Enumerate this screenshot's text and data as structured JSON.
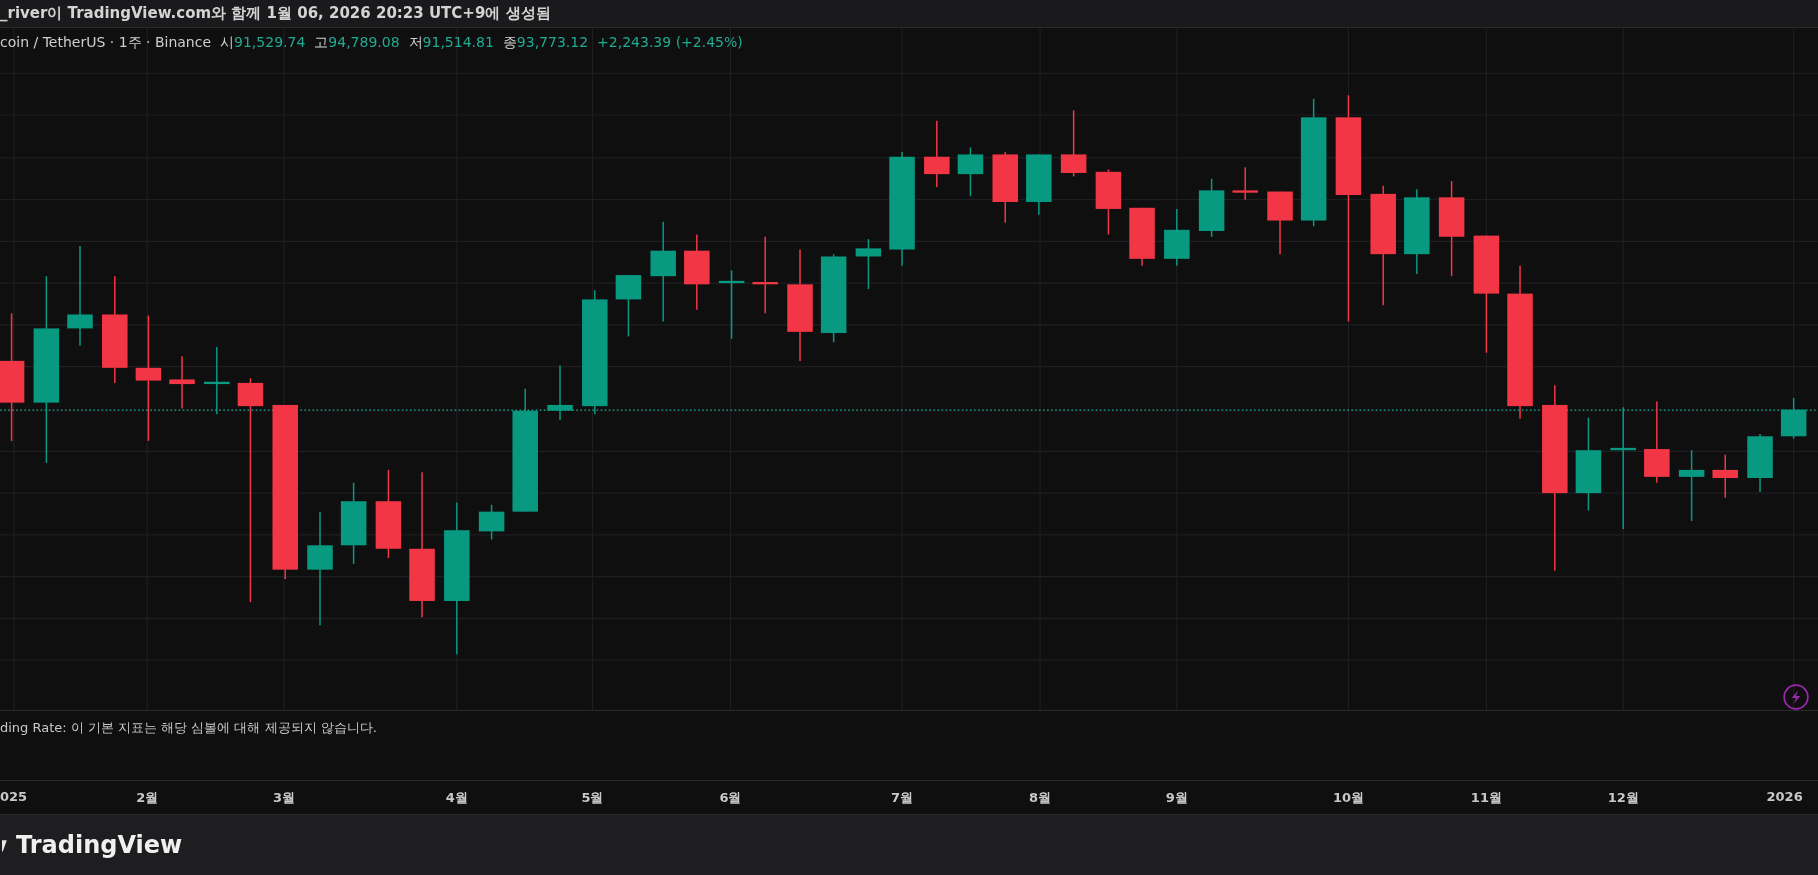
{
  "title_bar": {
    "text": "_river이 TradingView.com와 함께 1월 06, 2026 20:23 UTC+9에 생성됨"
  },
  "legend": {
    "symbol": "coin / TetherUS · 1주 · Binance",
    "fields": [
      {
        "label": "시",
        "value": "91,529.74"
      },
      {
        "label": "고",
        "value": "94,789.08"
      },
      {
        "label": "저",
        "value": "91,514.81"
      },
      {
        "label": "종",
        "value": "93,773.12"
      }
    ],
    "change": {
      "text": "+2,243.39 (+2.45%)"
    }
  },
  "indicator_pane": {
    "message": "ding Rate: 이 기본 지표는 해당 심볼에 대해 제공되지 않습니다."
  },
  "time_axis": {
    "labels": [
      "025",
      "2월",
      "3월",
      "4월",
      "5월",
      "6월",
      "7월",
      "8월",
      "9월",
      "10월",
      "11월",
      "12월",
      "2026"
    ]
  },
  "footer": {
    "brand": "TradingView"
  }
}
